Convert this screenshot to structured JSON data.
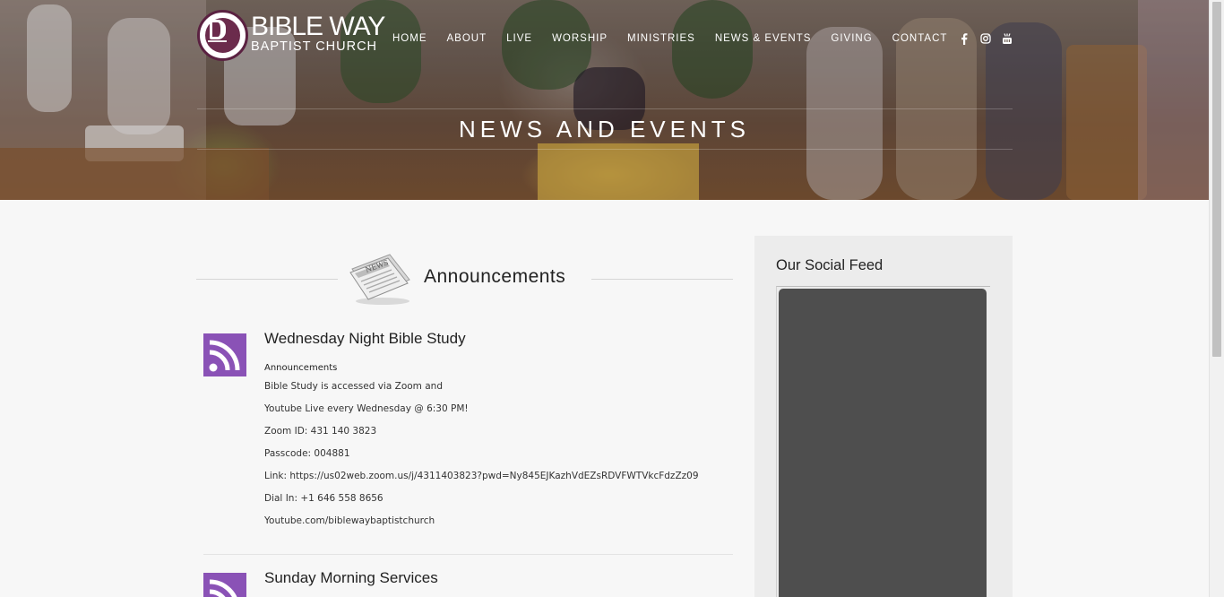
{
  "header": {
    "logo_line1": "BIBLE WAY",
    "logo_line2": "BAPTIST CHURCH",
    "nav": [
      {
        "label": "HOME"
      },
      {
        "label": "ABOUT"
      },
      {
        "label": "LIVE"
      },
      {
        "label": "WORSHIP"
      },
      {
        "label": "MINISTRIES"
      },
      {
        "label": "NEWS & EVENTS"
      },
      {
        "label": "GIVING"
      },
      {
        "label": "CONTACT"
      }
    ],
    "social_icons": [
      "facebook-icon",
      "instagram-icon",
      "youtube-icon"
    ],
    "page_title": "NEWS AND EVENTS"
  },
  "main": {
    "section_title": "Announcements",
    "posts": [
      {
        "title": "Wednesday Night Bible Study",
        "category": "Announcements",
        "lines": [
          "Bible Study is accessed via Zoom and",
          "Youtube Live every Wednesday @ 6:30 PM!",
          "Zoom ID: 431 140 3823",
          "Passcode: 004881",
          "Link: https://us02web.zoom.us/j/4311403823?pwd=Ny845EJKazhVdEZsRDVFWTVkcFdzZz09",
          "Dial In: +1 646 558 8656",
          "Youtube.com/biblewaybaptistchurch"
        ]
      },
      {
        "title": "Sunday Morning Services"
      }
    ]
  },
  "sidebar": {
    "title": "Our Social Feed"
  },
  "colors": {
    "accent_rss": "#8a52b6",
    "logo_maroon": "#5a2141",
    "feed_box": "#4e4e4e"
  }
}
